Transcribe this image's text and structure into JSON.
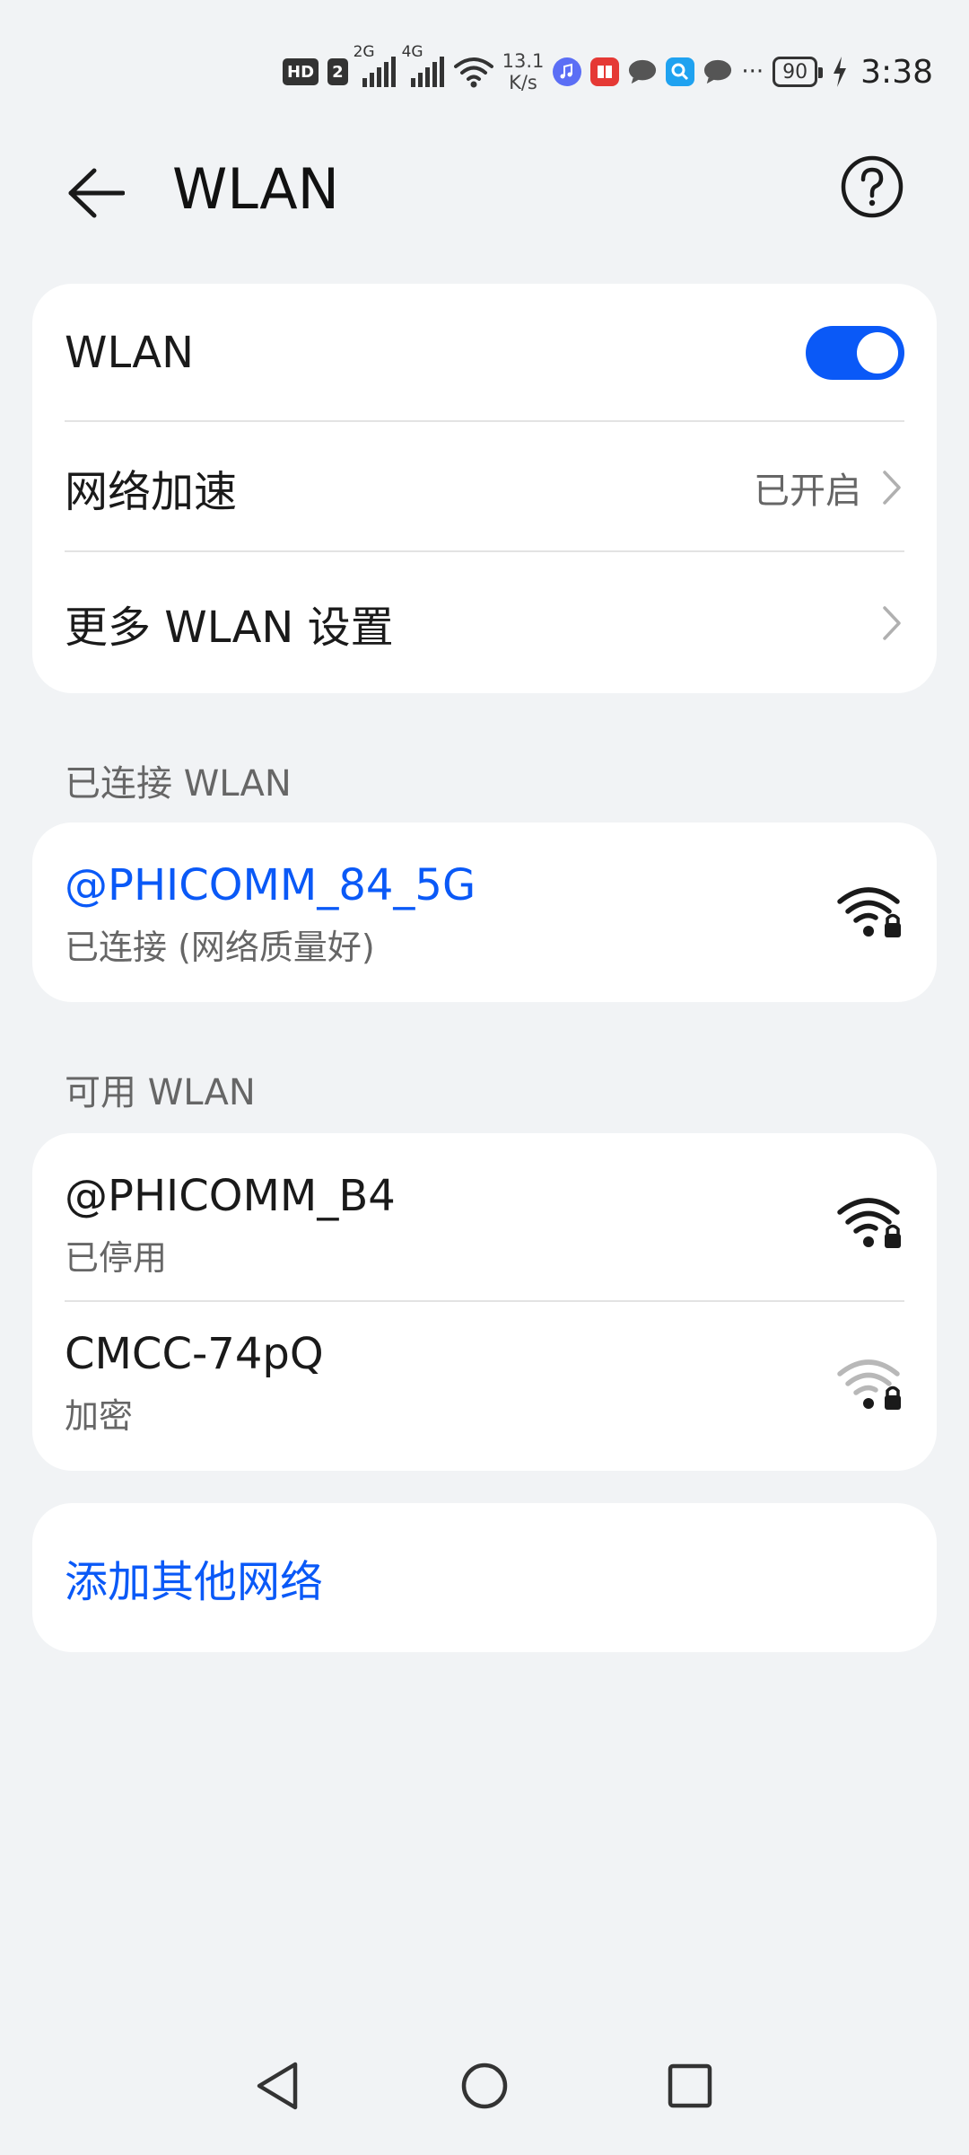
{
  "status_bar": {
    "hd_badge": "HD",
    "sim2_badge": "2",
    "net1": "2G",
    "net2": "4G",
    "speed_value": "13.1",
    "speed_unit": "K/s",
    "ellipsis": "···",
    "battery": "90",
    "time": "3:38"
  },
  "header": {
    "title": "WLAN"
  },
  "settings_card": {
    "wlan_label": "WLAN",
    "wlan_enabled": true,
    "accel_label": "网络加速",
    "accel_value": "已开启",
    "more_label": "更多 WLAN 设置"
  },
  "connected_section": {
    "label": "已连接 WLAN",
    "network": {
      "name": "@PHICOMM_84_5G",
      "status": "已连接 (网络质量好)"
    }
  },
  "available_section": {
    "label": "可用 WLAN",
    "networks": [
      {
        "name": "@PHICOMM_B4",
        "status": "已停用"
      },
      {
        "name": "CMCC-74pQ",
        "status": "加密"
      }
    ]
  },
  "add_network": {
    "label": "添加其他网络"
  },
  "colors": {
    "accent": "#0a59f7",
    "background": "#f1f3f5",
    "card": "#ffffff",
    "weak_signal": "#b8b8b8"
  }
}
